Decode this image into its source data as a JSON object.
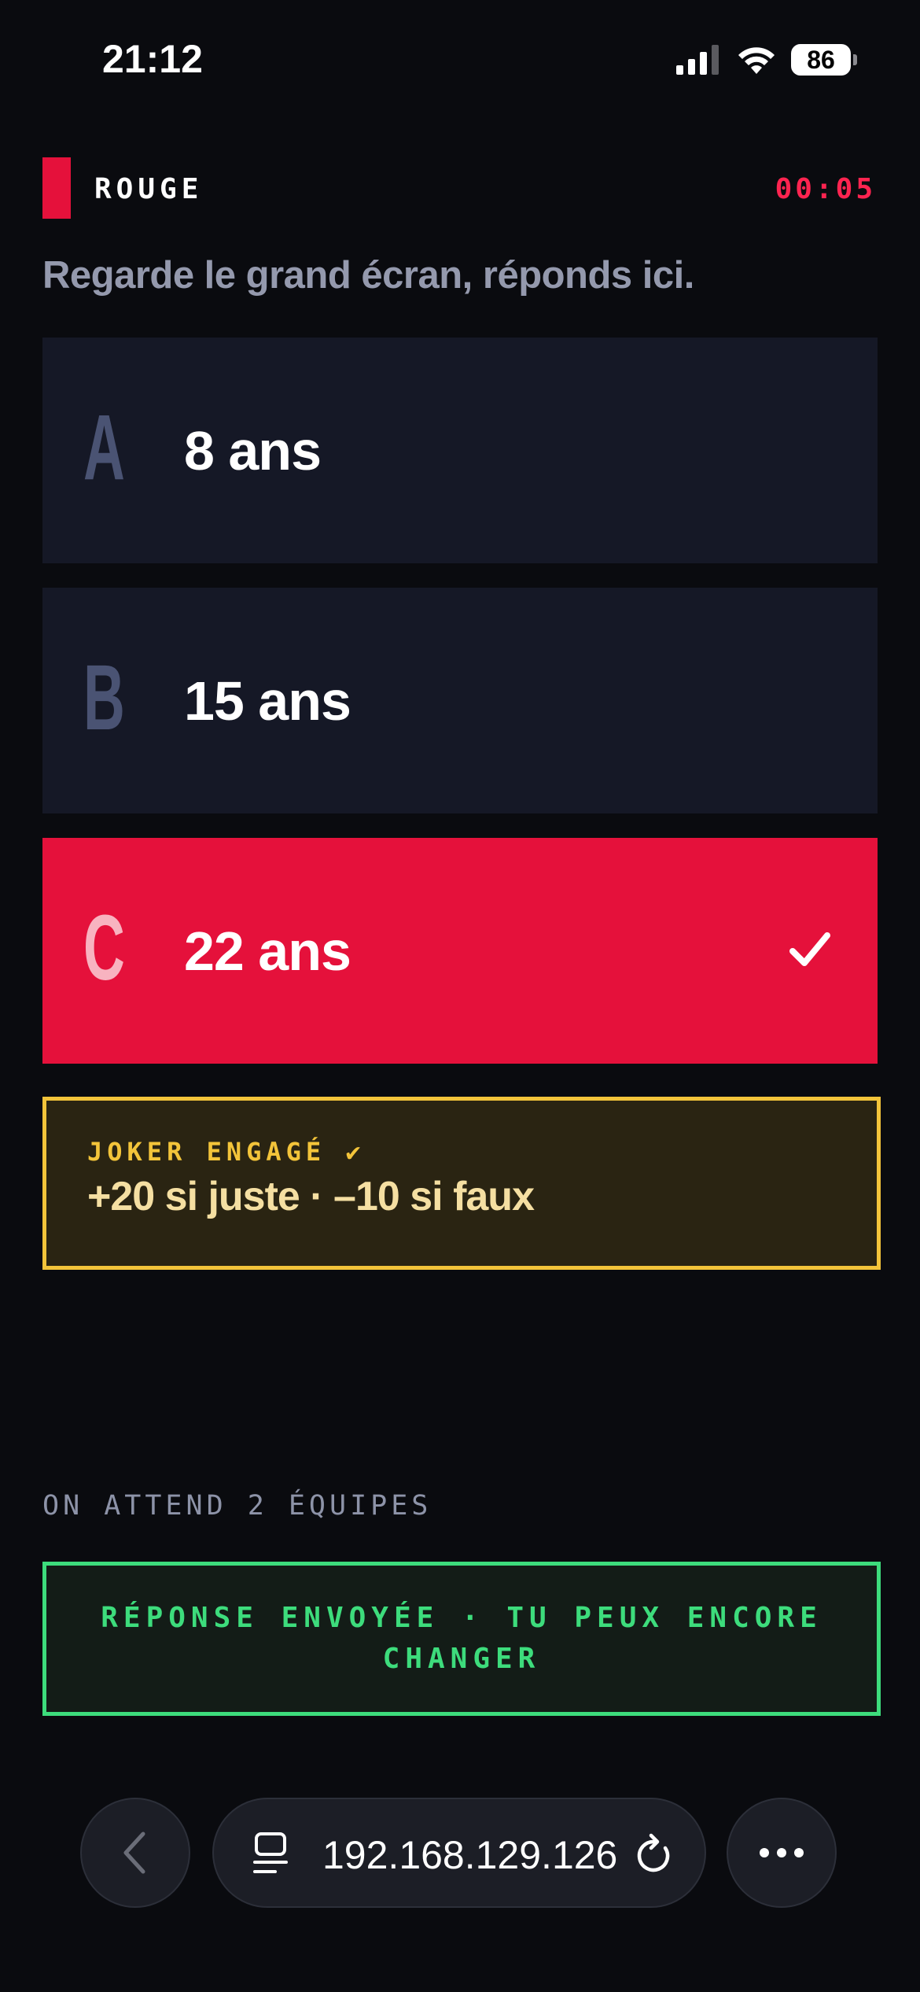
{
  "status_bar": {
    "time": "21:12",
    "battery": "86"
  },
  "header": {
    "team_name": "ROUGE",
    "team_color": "#e5113b",
    "timer": "00:05"
  },
  "subtitle": "Regarde le grand écran, réponds ici.",
  "answers": [
    {
      "letter": "A",
      "text": "8 ans",
      "selected": false
    },
    {
      "letter": "B",
      "text": "15 ans",
      "selected": false
    },
    {
      "letter": "C",
      "text": "22 ans",
      "selected": true
    }
  ],
  "joker": {
    "label": "JOKER ENGAGÉ ✔",
    "detail": "+20 si juste · –10 si faux"
  },
  "waiting_text": "ON ATTEND 2 ÉQUIPES",
  "sent_status": "RÉPONSE ENVOYÉE · TU PEUX ENCORE CHANGER",
  "browser": {
    "address": "192.168.129.126"
  },
  "colors": {
    "background": "#0a0b0f",
    "answer_bg": "#151826",
    "selected": "#e5113b",
    "joker": "#f3c43a",
    "success": "#3ddc7c"
  },
  "icons": {
    "signal": "cellular-signal-icon",
    "wifi": "wifi-icon",
    "battery": "battery-icon",
    "check": "checkmark-icon",
    "back": "chevron-left-icon",
    "tabs": "tabs-icon",
    "reload": "reload-icon",
    "more": "more-dots-icon"
  }
}
